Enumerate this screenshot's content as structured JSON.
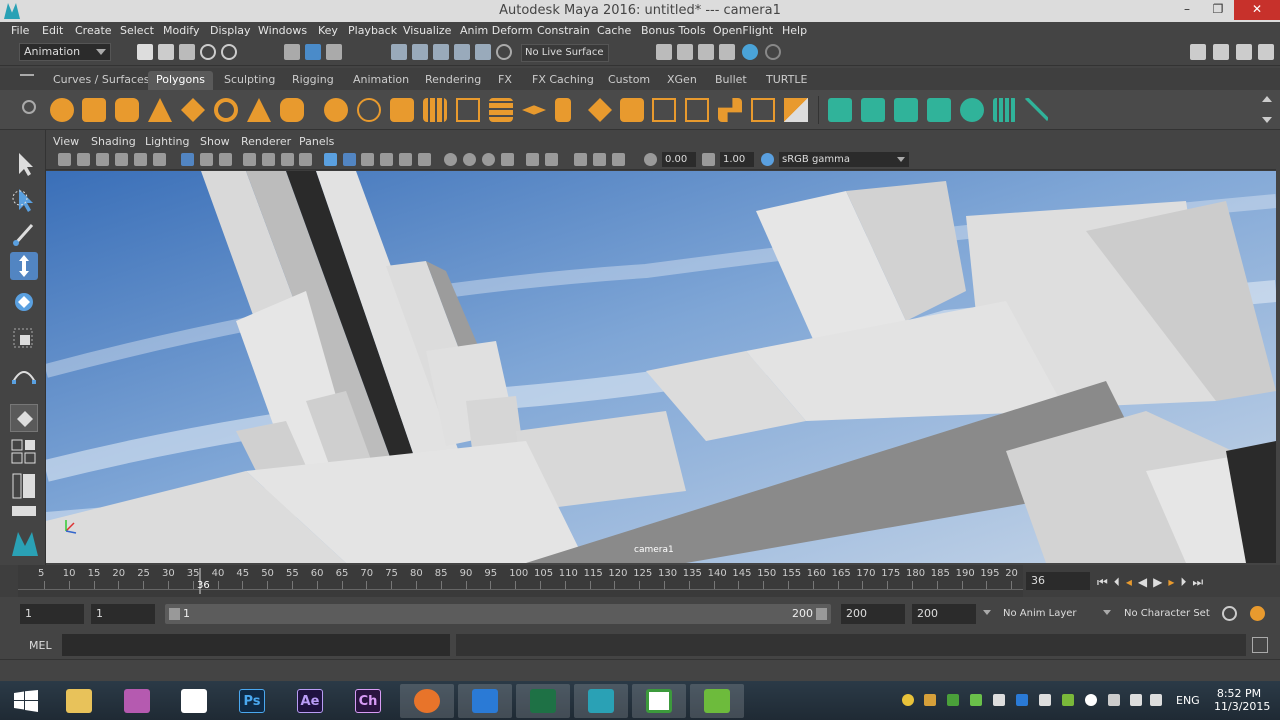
{
  "titlebar": {
    "title": "Autodesk Maya 2016: untitled*    ---    camera1",
    "minimize": "–",
    "restore": "❐",
    "close": "✕"
  },
  "menubar": [
    "File",
    "Edit",
    "Create",
    "Select",
    "Modify",
    "Display",
    "Windows",
    "Key",
    "Playback",
    "Visualize",
    "Anim Deform",
    "Constrain",
    "Cache",
    "Bonus Tools",
    "OpenFlight",
    "Help"
  ],
  "statusline": {
    "menuset": "Animation",
    "live_surface": "No Live Surface"
  },
  "shelf_tabs": [
    "Curves / Surfaces",
    "Polygons",
    "Sculpting",
    "Rigging",
    "Animation",
    "Rendering",
    "FX",
    "FX Caching",
    "Custom",
    "XGen",
    "Bullet",
    "TURTLE"
  ],
  "shelf_active_tab": "Polygons",
  "panel_menu": [
    "View",
    "Shading",
    "Lighting",
    "Show",
    "Renderer",
    "Panels"
  ],
  "panel_toolbar": {
    "exposure": "0.00",
    "gamma": "1.00",
    "color_space": "sRGB gamma"
  },
  "viewport": {
    "camera_label": "camera1"
  },
  "timeslider": {
    "ticks": [
      "5",
      "10",
      "15",
      "20",
      "25",
      "30",
      "35",
      "40",
      "45",
      "50",
      "55",
      "60",
      "65",
      "70",
      "75",
      "80",
      "85",
      "90",
      "95",
      "100",
      "105",
      "110",
      "115",
      "120",
      "125",
      "130",
      "135",
      "140",
      "145",
      "150",
      "155",
      "160",
      "165",
      "170",
      "175",
      "180",
      "185",
      "190",
      "195",
      "20"
    ],
    "current_marker": "36",
    "current_frame": "36"
  },
  "rangeslider": {
    "start": "1",
    "anim_start": "1",
    "range_start_label": "1",
    "range_end_label": "200",
    "anim_end": "200",
    "end": "200",
    "anim_layer": "No Anim Layer",
    "character_set": "No Character Set"
  },
  "cmdline": {
    "label": "MEL"
  },
  "taskbar": {
    "apps": [
      "Ps",
      "Ae",
      "Ch"
    ],
    "language": "ENG",
    "time": "8:52 PM",
    "date": "11/3/2015"
  },
  "colors": {
    "maya_teal": "#2aa1b5",
    "polygon_orange": "#e89a2e",
    "shelf_green": "#30b39a",
    "close_red": "#c7312b"
  }
}
